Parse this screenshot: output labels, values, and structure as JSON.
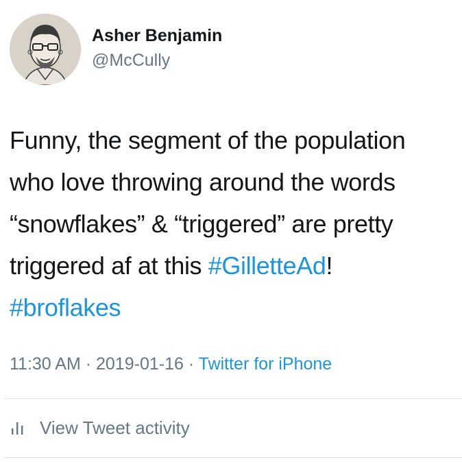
{
  "user": {
    "display_name": "Asher Benjamin",
    "handle": "@McCully"
  },
  "tweet": {
    "lines": [
      [
        {
          "text": "Funny, the segment of the population",
          "hashtag": false
        }
      ],
      [
        {
          "text": "who love throwing around the words",
          "hashtag": false
        }
      ],
      [
        {
          "text": "“snowflakes” & “triggered” are pretty",
          "hashtag": false
        }
      ],
      [
        {
          "text": "triggered af at this ",
          "hashtag": false
        },
        {
          "text": "#GilletteAd",
          "hashtag": true
        },
        {
          "text": "!",
          "hashtag": false
        }
      ],
      [
        {
          "text": "#broflakes",
          "hashtag": true
        }
      ]
    ]
  },
  "meta": {
    "time": "11:30 AM",
    "separator": " · ",
    "date": "2019-01-16",
    "source": "Twitter for iPhone"
  },
  "actions": {
    "activity_label": "View Tweet activity",
    "activity_icon": "bar-chart-icon"
  },
  "colors": {
    "text": "#14171a",
    "secondary": "#657786",
    "link": "#1b95e0",
    "divider": "#dfe3e6"
  }
}
